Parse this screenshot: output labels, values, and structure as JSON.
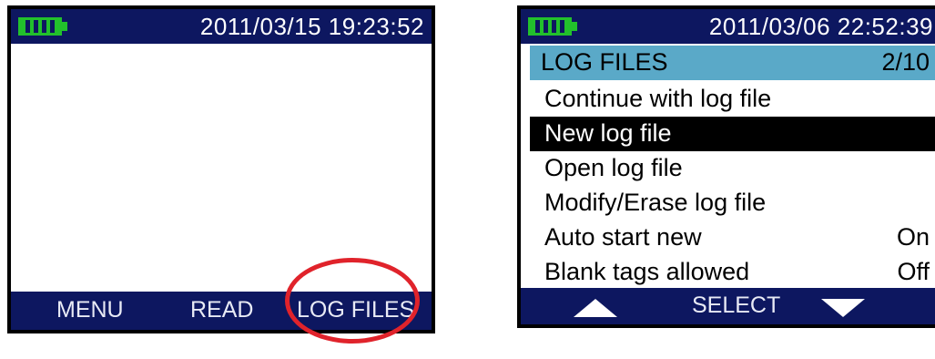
{
  "screen1": {
    "datetime": "2011/03/15  19:23:52",
    "softkeys": {
      "left": "MENU",
      "center": "READ",
      "right": "LOG FILES"
    },
    "colors": {
      "statusbar": "#0d1760",
      "battery": "#22c02c",
      "highlight_circle": "#e0232b"
    }
  },
  "screen2": {
    "datetime": "2011/03/06  22:52:39",
    "title": {
      "label": "LOG FILES",
      "page": "2/10"
    },
    "menu": [
      {
        "label": "Continue with log file",
        "value": ""
      },
      {
        "label": "New log file",
        "value": "",
        "selected": true
      },
      {
        "label": "Open log file",
        "value": ""
      },
      {
        "label": "Modify/Erase log file",
        "value": ""
      },
      {
        "label": "Auto start new",
        "value": "On"
      },
      {
        "label": "Blank tags allowed",
        "value": "Off"
      }
    ],
    "softkeys": {
      "left": "up-arrow-icon",
      "center": "SELECT",
      "right": "down-arrow-icon"
    },
    "colors": {
      "title_bg": "#5aa9c8",
      "selected_bg": "#000000"
    }
  }
}
